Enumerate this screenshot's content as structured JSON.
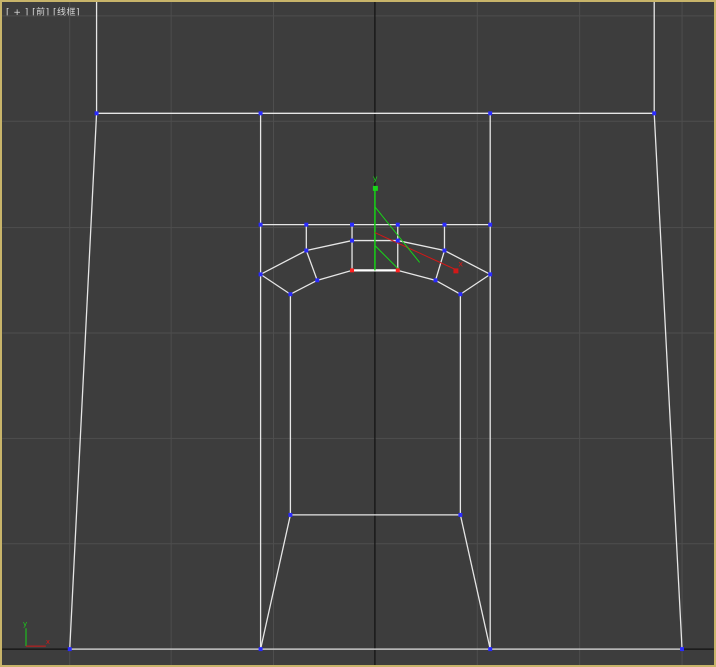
{
  "viewport": {
    "label": "[ + ] [前] [线框]",
    "view_name": "front",
    "shading": "wireframe",
    "grid": true,
    "colors": {
      "background": "#3d3d3d",
      "grid_line": "#4e4e4e",
      "grid_axis": "#111111",
      "wire": "#e6e6e6",
      "vertex": "#2a2aff",
      "vertex_selected": "#ff2020",
      "gizmo_y": "#18d418",
      "gizmo_x": "#d21818",
      "active_border": "#c8b46a"
    }
  },
  "gizmo": {
    "y_label": "y",
    "x_label": "x",
    "icon": "move-gizmo-icon"
  },
  "axis_tripod": {
    "y_label": "y",
    "x_label": "x",
    "icon": "world-axis-tripod-icon"
  }
}
